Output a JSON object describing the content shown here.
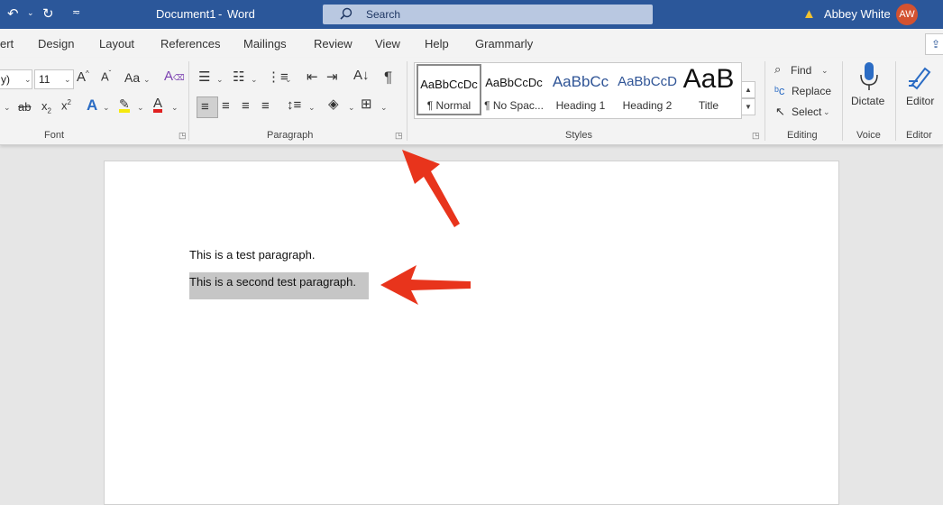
{
  "titlebar": {
    "doc_title": "Document1",
    "separator": "-",
    "app_name": "Word",
    "search_placeholder": "Search",
    "user_name": "Abbey White",
    "user_initials": "AW"
  },
  "tabs": [
    "ert",
    "Design",
    "Layout",
    "References",
    "Mailings",
    "Review",
    "View",
    "Help",
    "Grammarly"
  ],
  "font_group": {
    "font_name": "y)",
    "font_size": "11",
    "label": "Font"
  },
  "paragraph_group": {
    "label": "Paragraph"
  },
  "styles_group": {
    "label": "Styles",
    "items": [
      {
        "preview": "AaBbCcDc",
        "name": "¶ Normal"
      },
      {
        "preview": "AaBbCcDc",
        "name": "¶ No Spac..."
      },
      {
        "preview": "AaBbCc",
        "name": "Heading 1"
      },
      {
        "preview": "AaBbCcD",
        "name": "Heading 2"
      },
      {
        "preview": "AaB",
        "name": "Title"
      }
    ]
  },
  "editing_group": {
    "label": "Editing",
    "find": "Find",
    "replace": "Replace",
    "select": "Select"
  },
  "voice_group": {
    "label": "Voice",
    "dictate": "Dictate"
  },
  "editor_group": {
    "label": "Editor",
    "editor": "Editor"
  },
  "document": {
    "paragraphs": [
      "This is a test paragraph.",
      "This is a second test paragraph."
    ]
  },
  "colors": {
    "titlebar": "#2b579a",
    "arrow": "#e8341c",
    "highlight": "#c6c6c6",
    "avatar": "#d35230"
  }
}
